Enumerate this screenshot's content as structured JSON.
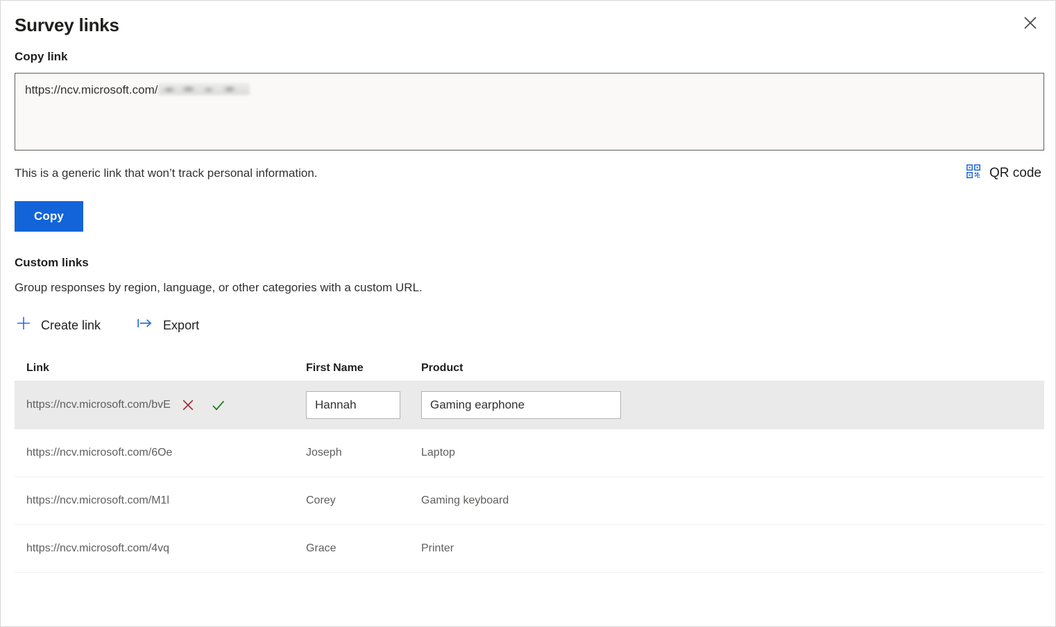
{
  "panel": {
    "title": "Survey links",
    "close_icon": "close-icon"
  },
  "copy_link": {
    "label": "Copy link",
    "url_prefix": "https://ncv.microsoft.com/",
    "url_suffix_redacted": "",
    "note": "This is a generic link that won’t track personal information.",
    "qr_label": "QR code",
    "qr_icon": "qr-code-icon",
    "copy_button": "Copy"
  },
  "custom_links": {
    "title": "Custom links",
    "description": "Group responses by region, language, or other categories with a custom URL.",
    "commands": [
      {
        "label": "Create link",
        "icon": "plus-icon"
      },
      {
        "label": "Export",
        "icon": "export-icon"
      }
    ],
    "table": {
      "columns": [
        "Link",
        "First Name",
        "Product"
      ],
      "rows": [
        {
          "link": "https://ncv.microsoft.com/bvE",
          "first_name": "Hannah",
          "product": "Gaming earphone",
          "editing": true,
          "cancel_icon": "cancel-x-icon",
          "confirm_icon": "confirm-check-icon"
        },
        {
          "link": "https://ncv.microsoft.com/6Oe",
          "first_name": "Joseph",
          "product": "Laptop",
          "editing": false
        },
        {
          "link": "https://ncv.microsoft.com/M1l",
          "first_name": "Corey",
          "product": "Gaming keyboard",
          "editing": false
        },
        {
          "link": "https://ncv.microsoft.com/4vq",
          "first_name": "Grace",
          "product": "Printer",
          "editing": false
        }
      ]
    }
  },
  "colors": {
    "accent": "#1264d8",
    "qr_icon": "#2b6ce0",
    "cancel": "#a4262c",
    "confirm": "#107c10",
    "selected_row": "#eaeaea",
    "text_primary": "#201f1e",
    "text_secondary": "#605e5c"
  }
}
